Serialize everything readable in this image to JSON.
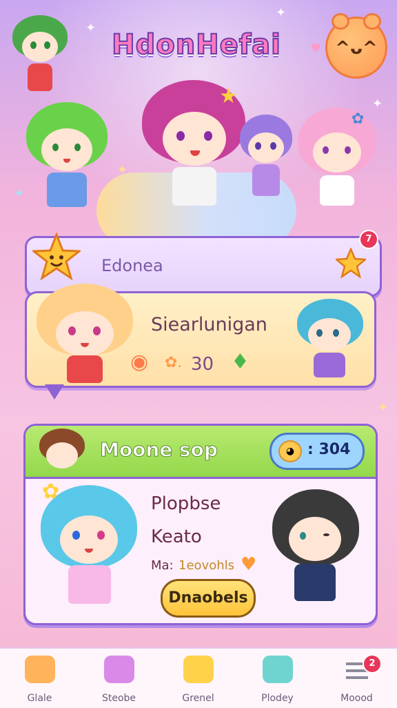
{
  "game": {
    "title": "HdonHefai"
  },
  "top_card": {
    "label": "Edonea",
    "notification_count": "7"
  },
  "speech_bubble": {
    "character_name": "Siearlunigan",
    "score": "30"
  },
  "mode_card": {
    "header_title": "Moone sop",
    "currency_value": ": 304",
    "line1": "Plopbse",
    "line2": "Keato",
    "small_label": "Ma:",
    "small_value": "1eovohls",
    "action_button": "Dnaobels"
  },
  "bottom_nav": [
    {
      "label": "Glale",
      "icon": "home-icon",
      "color": "#ffb35a"
    },
    {
      "label": "Steobe",
      "icon": "chest-icon",
      "color": "#d98ae8"
    },
    {
      "label": "Grenel",
      "icon": "shop-icon",
      "color": "#ffd24a"
    },
    {
      "label": "Plodey",
      "icon": "chat-icon",
      "color": "#6fd4d0"
    },
    {
      "label": "Moood",
      "icon": "menu-icon",
      "color": "#8a8a9a",
      "badge": "2"
    }
  ],
  "colors": {
    "accent": "#8e62d4",
    "green_header": "#93d84a",
    "button": "#ffc43a"
  }
}
